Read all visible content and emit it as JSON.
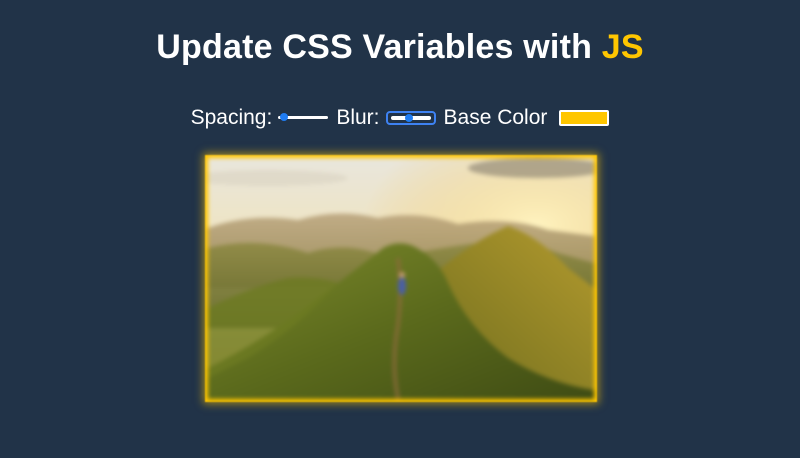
{
  "header": {
    "title_prefix": "Update CSS Variables with ",
    "title_highlight": "JS"
  },
  "controls": {
    "spacing_label": "Spacing:",
    "spacing_value": 10,
    "spacing_min": 10,
    "spacing_max": 200,
    "blur_label": "Blur:",
    "blur_value": 10,
    "blur_min": 0,
    "blur_max": 25,
    "base_color_label": "Base Color",
    "base_color_value": "#ffc600"
  },
  "colors": {
    "background": "#213348",
    "accent": "#ffc600",
    "slider_thumb": "#1f7cf2"
  },
  "image": {
    "subject": "mountain ridge hiker at sunset"
  }
}
